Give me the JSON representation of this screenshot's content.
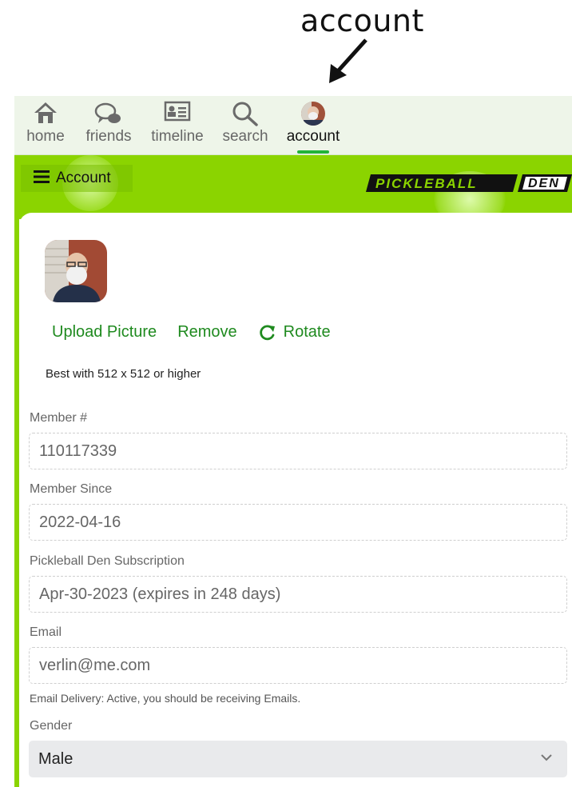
{
  "annotation": {
    "label": "account"
  },
  "nav": {
    "items": [
      {
        "label": "home",
        "icon": "home-icon"
      },
      {
        "label": "friends",
        "icon": "friends-icon"
      },
      {
        "label": "timeline",
        "icon": "timeline-icon"
      },
      {
        "label": "search",
        "icon": "search-icon"
      },
      {
        "label": "account",
        "icon": "avatar",
        "active": true
      }
    ]
  },
  "header": {
    "menu_label": "Account",
    "logo_text": "PICKLEBALL DEN",
    "accent_color": "#8bd400"
  },
  "profile": {
    "upload_label": "Upload Picture",
    "remove_label": "Remove",
    "rotate_label": "Rotate",
    "hint": "Best with 512 x 512 or higher"
  },
  "fields": {
    "member_number": {
      "label": "Member #",
      "value": "110117339"
    },
    "member_since": {
      "label": "Member Since",
      "value": "2022-04-16"
    },
    "subscription": {
      "label": "Pickleball Den Subscription",
      "value": "Apr-30-2023 (expires in 248 days)"
    },
    "email": {
      "label": "Email",
      "value": "verlin@me.com",
      "help": "Email Delivery: Active, you should be receiving Emails."
    },
    "gender": {
      "label": "Gender",
      "value": "Male"
    }
  },
  "colors": {
    "link_green": "#1f8a1f",
    "active_underline": "#22b43a"
  }
}
